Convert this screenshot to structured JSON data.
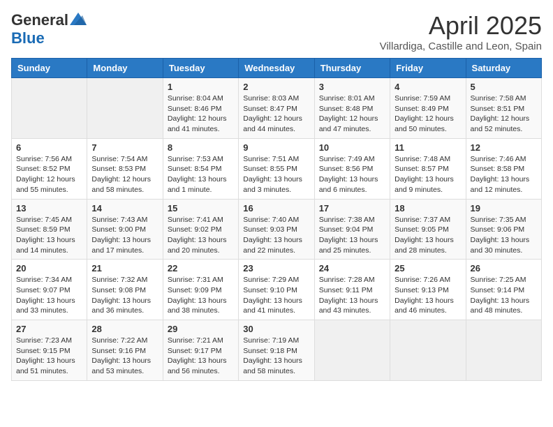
{
  "header": {
    "logo_general": "General",
    "logo_blue": "Blue",
    "month_title": "April 2025",
    "subtitle": "Villardiga, Castille and Leon, Spain"
  },
  "weekdays": [
    "Sunday",
    "Monday",
    "Tuesday",
    "Wednesday",
    "Thursday",
    "Friday",
    "Saturday"
  ],
  "weeks": [
    [
      {
        "day": "",
        "info": ""
      },
      {
        "day": "",
        "info": ""
      },
      {
        "day": "1",
        "info": "Sunrise: 8:04 AM\nSunset: 8:46 PM\nDaylight: 12 hours and 41 minutes."
      },
      {
        "day": "2",
        "info": "Sunrise: 8:03 AM\nSunset: 8:47 PM\nDaylight: 12 hours and 44 minutes."
      },
      {
        "day": "3",
        "info": "Sunrise: 8:01 AM\nSunset: 8:48 PM\nDaylight: 12 hours and 47 minutes."
      },
      {
        "day": "4",
        "info": "Sunrise: 7:59 AM\nSunset: 8:49 PM\nDaylight: 12 hours and 50 minutes."
      },
      {
        "day": "5",
        "info": "Sunrise: 7:58 AM\nSunset: 8:51 PM\nDaylight: 12 hours and 52 minutes."
      }
    ],
    [
      {
        "day": "6",
        "info": "Sunrise: 7:56 AM\nSunset: 8:52 PM\nDaylight: 12 hours and 55 minutes."
      },
      {
        "day": "7",
        "info": "Sunrise: 7:54 AM\nSunset: 8:53 PM\nDaylight: 12 hours and 58 minutes."
      },
      {
        "day": "8",
        "info": "Sunrise: 7:53 AM\nSunset: 8:54 PM\nDaylight: 13 hours and 1 minute."
      },
      {
        "day": "9",
        "info": "Sunrise: 7:51 AM\nSunset: 8:55 PM\nDaylight: 13 hours and 3 minutes."
      },
      {
        "day": "10",
        "info": "Sunrise: 7:49 AM\nSunset: 8:56 PM\nDaylight: 13 hours and 6 minutes."
      },
      {
        "day": "11",
        "info": "Sunrise: 7:48 AM\nSunset: 8:57 PM\nDaylight: 13 hours and 9 minutes."
      },
      {
        "day": "12",
        "info": "Sunrise: 7:46 AM\nSunset: 8:58 PM\nDaylight: 13 hours and 12 minutes."
      }
    ],
    [
      {
        "day": "13",
        "info": "Sunrise: 7:45 AM\nSunset: 8:59 PM\nDaylight: 13 hours and 14 minutes."
      },
      {
        "day": "14",
        "info": "Sunrise: 7:43 AM\nSunset: 9:00 PM\nDaylight: 13 hours and 17 minutes."
      },
      {
        "day": "15",
        "info": "Sunrise: 7:41 AM\nSunset: 9:02 PM\nDaylight: 13 hours and 20 minutes."
      },
      {
        "day": "16",
        "info": "Sunrise: 7:40 AM\nSunset: 9:03 PM\nDaylight: 13 hours and 22 minutes."
      },
      {
        "day": "17",
        "info": "Sunrise: 7:38 AM\nSunset: 9:04 PM\nDaylight: 13 hours and 25 minutes."
      },
      {
        "day": "18",
        "info": "Sunrise: 7:37 AM\nSunset: 9:05 PM\nDaylight: 13 hours and 28 minutes."
      },
      {
        "day": "19",
        "info": "Sunrise: 7:35 AM\nSunset: 9:06 PM\nDaylight: 13 hours and 30 minutes."
      }
    ],
    [
      {
        "day": "20",
        "info": "Sunrise: 7:34 AM\nSunset: 9:07 PM\nDaylight: 13 hours and 33 minutes."
      },
      {
        "day": "21",
        "info": "Sunrise: 7:32 AM\nSunset: 9:08 PM\nDaylight: 13 hours and 36 minutes."
      },
      {
        "day": "22",
        "info": "Sunrise: 7:31 AM\nSunset: 9:09 PM\nDaylight: 13 hours and 38 minutes."
      },
      {
        "day": "23",
        "info": "Sunrise: 7:29 AM\nSunset: 9:10 PM\nDaylight: 13 hours and 41 minutes."
      },
      {
        "day": "24",
        "info": "Sunrise: 7:28 AM\nSunset: 9:11 PM\nDaylight: 13 hours and 43 minutes."
      },
      {
        "day": "25",
        "info": "Sunrise: 7:26 AM\nSunset: 9:13 PM\nDaylight: 13 hours and 46 minutes."
      },
      {
        "day": "26",
        "info": "Sunrise: 7:25 AM\nSunset: 9:14 PM\nDaylight: 13 hours and 48 minutes."
      }
    ],
    [
      {
        "day": "27",
        "info": "Sunrise: 7:23 AM\nSunset: 9:15 PM\nDaylight: 13 hours and 51 minutes."
      },
      {
        "day": "28",
        "info": "Sunrise: 7:22 AM\nSunset: 9:16 PM\nDaylight: 13 hours and 53 minutes."
      },
      {
        "day": "29",
        "info": "Sunrise: 7:21 AM\nSunset: 9:17 PM\nDaylight: 13 hours and 56 minutes."
      },
      {
        "day": "30",
        "info": "Sunrise: 7:19 AM\nSunset: 9:18 PM\nDaylight: 13 hours and 58 minutes."
      },
      {
        "day": "",
        "info": ""
      },
      {
        "day": "",
        "info": ""
      },
      {
        "day": "",
        "info": ""
      }
    ]
  ]
}
